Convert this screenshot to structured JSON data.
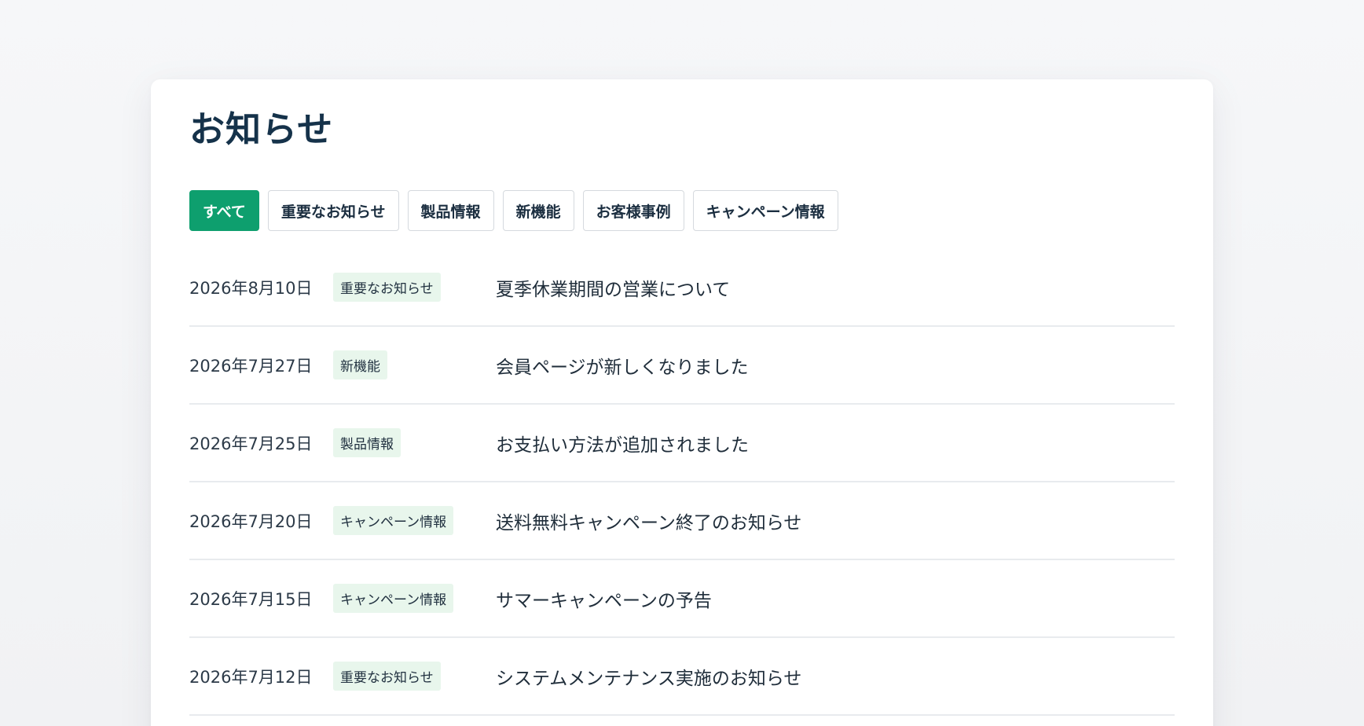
{
  "page": {
    "title": "お知らせ"
  },
  "filters": [
    {
      "label": "すべて",
      "active": true
    },
    {
      "label": "重要なお知らせ",
      "active": false
    },
    {
      "label": "製品情報",
      "active": false
    },
    {
      "label": "新機能",
      "active": false
    },
    {
      "label": "お客様事例",
      "active": false
    },
    {
      "label": "キャンペーン情報",
      "active": false
    }
  ],
  "news": [
    {
      "date": "2026年8月10日",
      "tag": "重要なお知らせ",
      "title": "夏季休業期間の営業について"
    },
    {
      "date": "2026年7月27日",
      "tag": "新機能",
      "title": "会員ページが新しくなりました"
    },
    {
      "date": "2026年7月25日",
      "tag": "製品情報",
      "title": "お支払い方法が追加されました"
    },
    {
      "date": "2026年7月20日",
      "tag": "キャンペーン情報",
      "title": "送料無料キャンペーン終了のお知らせ"
    },
    {
      "date": "2026年7月15日",
      "tag": "キャンペーン情報",
      "title": "サマーキャンペーンの予告"
    },
    {
      "date": "2026年7月12日",
      "tag": "重要なお知らせ",
      "title": "システムメンテナンス実施のお知らせ"
    }
  ],
  "colors": {
    "accent": "#0e9f6e",
    "tag_background": "#e8f6ec",
    "title_color": "#15324a"
  }
}
